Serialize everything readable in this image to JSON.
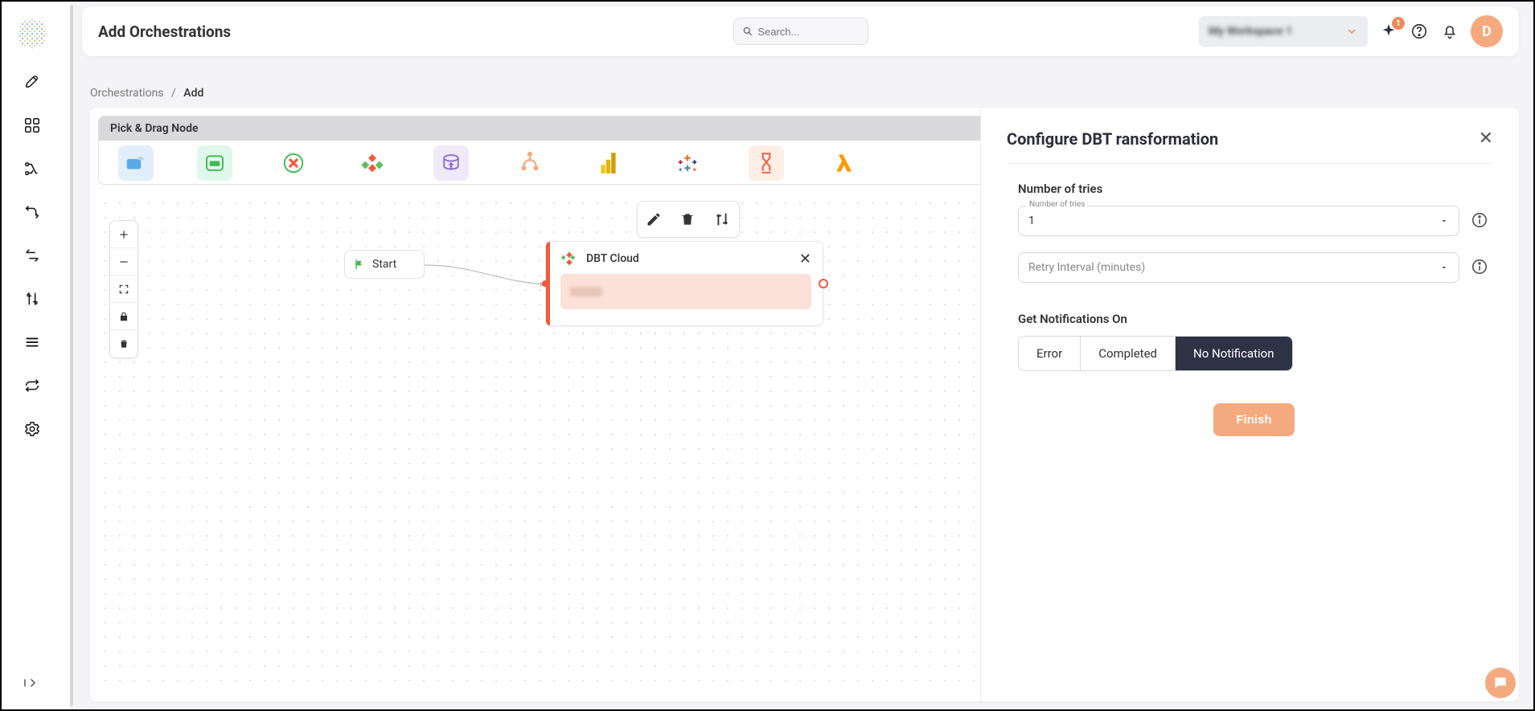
{
  "header": {
    "page_title": "Add Orchestrations",
    "search_placeholder": "Search...",
    "workspace_label": "My Workspace 1",
    "notification_badge": "1",
    "avatar_initial": "D"
  },
  "breadcrumb": {
    "root": "Orchestrations",
    "current": "Add"
  },
  "palette": {
    "header": "Pick & Drag Node",
    "items": [
      "source",
      "destination",
      "delete",
      "dbt",
      "db-push",
      "branch",
      "powerbi",
      "tableau",
      "timer",
      "lambda"
    ]
  },
  "canvas": {
    "start_label": "Start",
    "dbt_node_title": "DBT Cloud"
  },
  "config_panel": {
    "title": "Configure DBT ransformation",
    "tries_section_label": "Number of tries",
    "tries_field_label": "Number of tries",
    "tries_value": "1",
    "retry_interval_placeholder": "Retry Interval (minutes)",
    "notifications_label": "Get Notifications On",
    "notif_error": "Error",
    "notif_completed": "Completed",
    "notif_none": "No Notification",
    "finish_label": "Finish"
  }
}
